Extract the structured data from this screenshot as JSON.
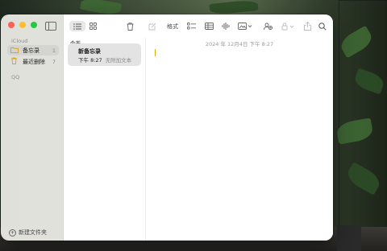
{
  "window": {
    "app": "Notes"
  },
  "sidebar": {
    "sections": [
      {
        "label": "iCloud",
        "folders": [
          {
            "icon": "folder-icon",
            "label": "备忘录",
            "count": "1",
            "selected": true
          },
          {
            "icon": "trash-icon",
            "label": "最近删除",
            "count": "7",
            "selected": false
          }
        ]
      },
      {
        "label": "QQ",
        "folders": []
      }
    ],
    "new_folder_label": "新建文件夹"
  },
  "toolbar": {
    "list_view_icon": "list-icon",
    "gallery_view_icon": "grid-icon",
    "delete_icon": "trash-icon",
    "compose_icon": "compose-icon",
    "format_label": "格式",
    "checklist_icon": "checklist-icon",
    "table_icon": "table-icon",
    "audio_icon": "waveform-icon",
    "media_icon": "photo-icon",
    "collab_icon": "collaborate-icon",
    "lock_icon": "lock-icon",
    "share_icon": "share-icon",
    "search_icon": "search-icon"
  },
  "notes_list": {
    "group_header": "今天",
    "notes": [
      {
        "title": "新备忘录",
        "time": "下午 8:27",
        "preview": "无附加文本",
        "selected": true
      }
    ]
  },
  "editor": {
    "date": "2024 年 12月4日 下午 8:27"
  },
  "colors": {
    "accent": "#e2a600",
    "close": "#fe5f57",
    "minimize": "#febc2e",
    "zoom": "#28c840"
  }
}
